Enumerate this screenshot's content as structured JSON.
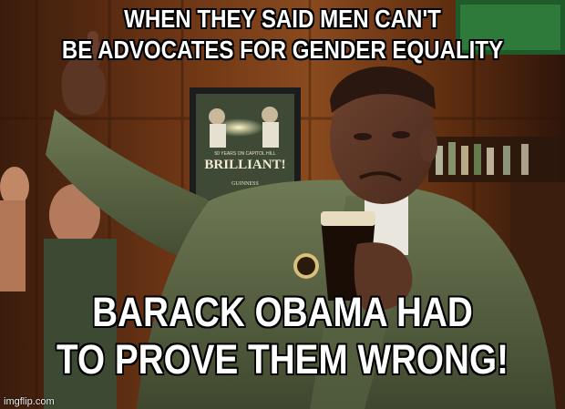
{
  "meme": {
    "top_text_line1": "WHEN THEY SAID MEN CAN'T",
    "top_text_line2": "BE ADVOCATES FOR GENDER EQUALITY",
    "bottom_text_line1": "BARACK OBAMA HAD",
    "bottom_text_line2": "TO PROVE THEM WRONG!",
    "watermark": "imgflip.com"
  },
  "poster": {
    "headline": "BRILLIANT!",
    "subline": "50 YEARS ON CAPITOL HILL",
    "brand": "GUINNESS"
  },
  "colors": {
    "wood_dark": "#3a1c0c",
    "wood_mid": "#6b3414",
    "wood_light": "#9a5424",
    "jacket": "#4f5a3c",
    "jacket_light": "#6f7a55",
    "skin": "#5a3424",
    "stout": "#1a0d06",
    "foam": "#e8dcc0",
    "caption_text": "#ffffff",
    "caption_outline": "#000000"
  }
}
